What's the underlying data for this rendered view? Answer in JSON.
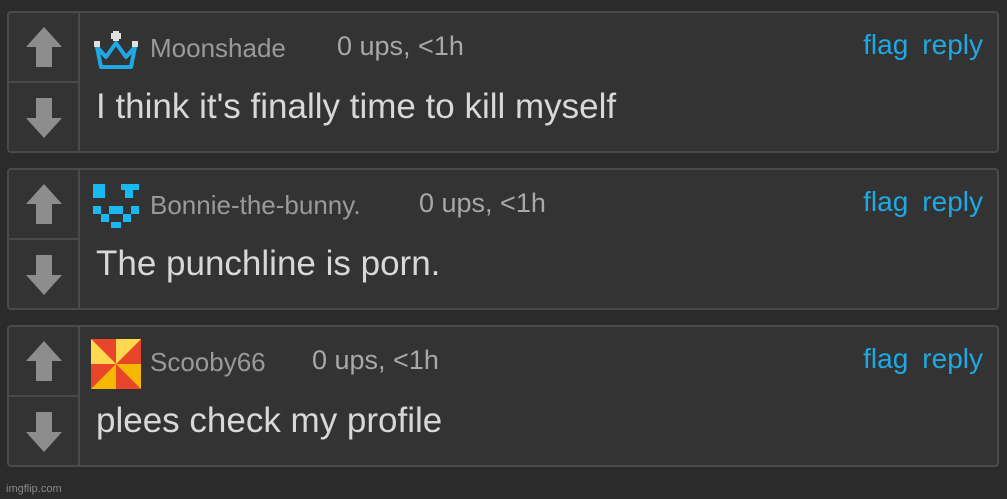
{
  "comments": [
    {
      "username": "Moonshade",
      "meta": "0 ups, <1h",
      "flag": "flag",
      "reply": "reply",
      "text": "I think it's finally time to kill myself",
      "avatar_icon": "crown-icon",
      "avatar_color": "#1fa8e3"
    },
    {
      "username": "Bonnie-the-bunny.",
      "meta": "0 ups, <1h",
      "flag": "flag",
      "reply": "reply",
      "text": "The punchline is porn.",
      "avatar_icon": "pixel-face-icon",
      "avatar_color": "#18b8f0"
    },
    {
      "username": "Scooby66",
      "meta": "0 ups, <1h",
      "flag": "flag",
      "reply": "reply",
      "text": "plees check my profile",
      "avatar_icon": "pinwheel-icon",
      "avatar_color": "#f5b800"
    }
  ],
  "vote": {
    "up_icon": "arrow-up-icon",
    "down_icon": "arrow-down-icon",
    "color": "#8d8d8d"
  },
  "footer": {
    "watermark": "imgflip.com"
  }
}
